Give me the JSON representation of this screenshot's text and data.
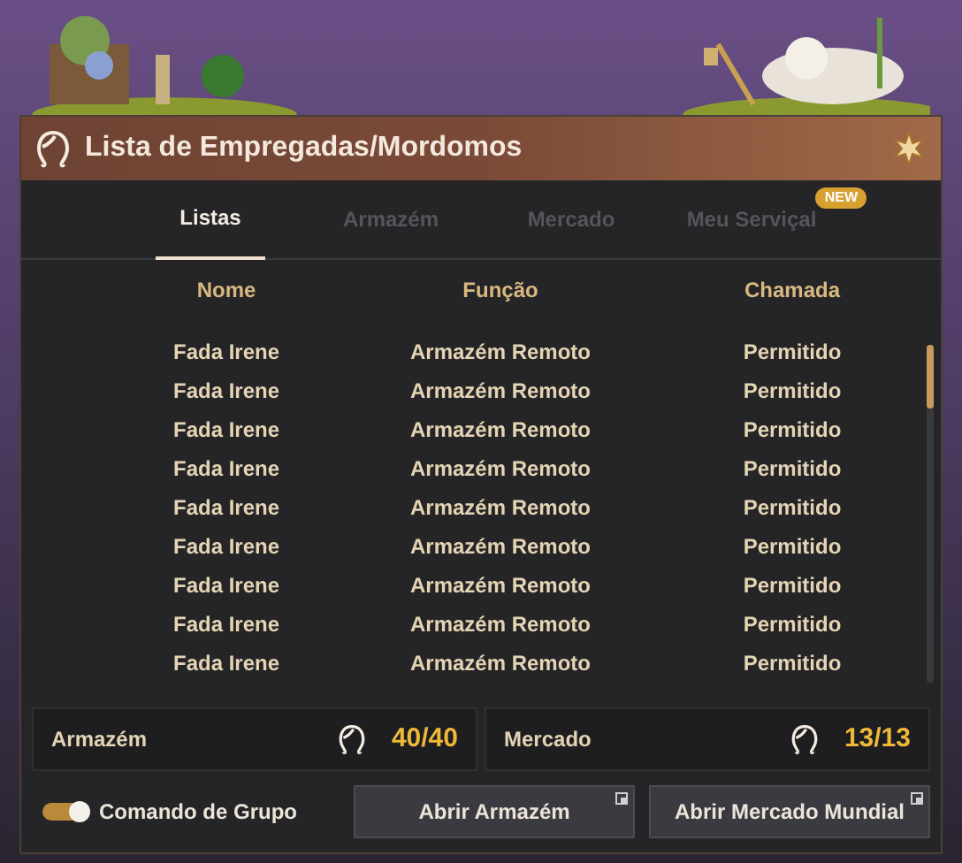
{
  "window": {
    "title": "Lista de Empregadas/Mordomos"
  },
  "tabs": [
    {
      "label": "Listas",
      "selected": true
    },
    {
      "label": "Armazém",
      "selected": false
    },
    {
      "label": "Mercado",
      "selected": false
    },
    {
      "label": "Meu Serviçal",
      "selected": false,
      "badge": "NEW"
    }
  ],
  "table": {
    "columns": [
      "Nome",
      "Função",
      "Chamada"
    ],
    "rows": [
      [
        "Fada Irene",
        "Armazém Remoto",
        "Permitido"
      ],
      [
        "Fada Irene",
        "Armazém Remoto",
        "Permitido"
      ],
      [
        "Fada Irene",
        "Armazém Remoto",
        "Permitido"
      ],
      [
        "Fada Irene",
        "Armazém Remoto",
        "Permitido"
      ],
      [
        "Fada Irene",
        "Armazém Remoto",
        "Permitido"
      ],
      [
        "Fada Irene",
        "Armazém Remoto",
        "Permitido"
      ],
      [
        "Fada Irene",
        "Armazém Remoto",
        "Permitido"
      ],
      [
        "Fada Irene",
        "Armazém Remoto",
        "Permitido"
      ],
      [
        "Fada Irene",
        "Armazém Remoto",
        "Permitido"
      ]
    ]
  },
  "stats": [
    {
      "label": "Armazém",
      "count": "40/40"
    },
    {
      "label": "Mercado",
      "count": "13/13"
    }
  ],
  "toggle": {
    "label": "Comando de Grupo",
    "on": true
  },
  "buttons": [
    "Abrir Armazém",
    "Abrir Mercado Mundial"
  ]
}
